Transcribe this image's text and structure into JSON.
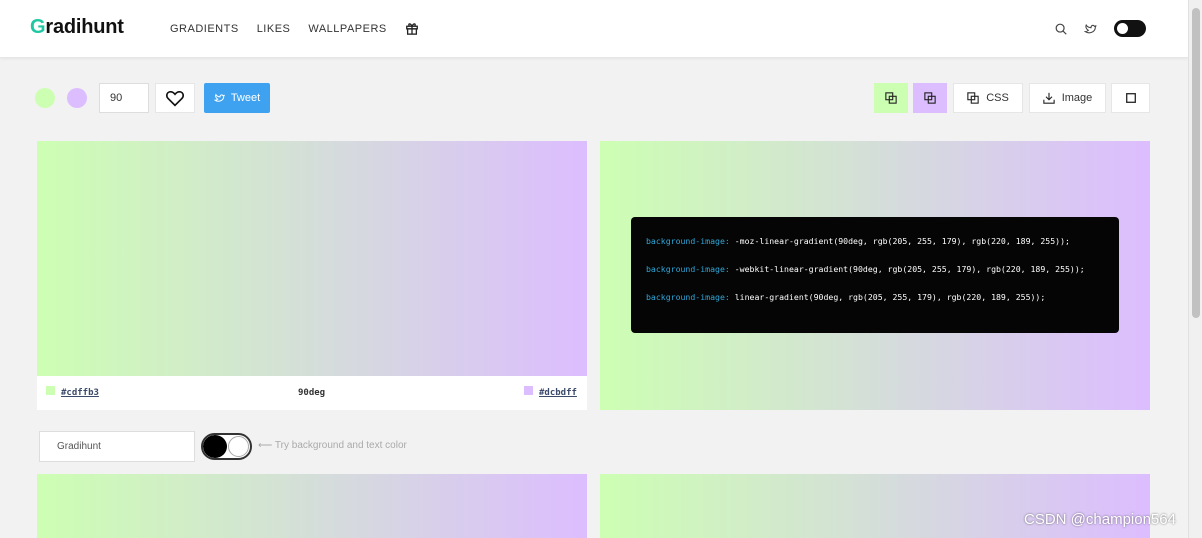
{
  "header": {
    "logo": "Gradihunt",
    "logo_first": "G",
    "logo_rest": "radihunt",
    "nav": [
      "GRADIENTS",
      "LIKES",
      "WALLPAPERS"
    ],
    "icons": [
      "gift-icon",
      "search-icon",
      "twitter-icon",
      "dark-mode-toggle"
    ]
  },
  "toolbar": {
    "color1": "#cdffb3",
    "color2": "#dcbdff",
    "degree_value": "90",
    "tweet_label": "Tweet",
    "css_label": "CSS",
    "image_label": "Image"
  },
  "gradient_card": {
    "color1_hex": "#cdffb3",
    "color2_hex": "#dcbdff",
    "degree_label": "90deg"
  },
  "code": {
    "lines": [
      {
        "prop": "background-image:",
        "value": " -moz-linear-gradient(90deg, rgb(205, 255, 179), rgb(220, 189, 255));"
      },
      {
        "prop": "background-image:",
        "value": " -webkit-linear-gradient(90deg, rgb(205, 255, 179), rgb(220, 189, 255));"
      },
      {
        "prop": "background-image:",
        "value": " linear-gradient(90deg, rgb(205, 255, 179), rgb(220, 189, 255));"
      }
    ]
  },
  "preview": {
    "text_value": "Gradihunt",
    "hint": "⟵ Try background and text color"
  },
  "watermark": "CSDN @champion564",
  "colors": {
    "accent_green": "#cdffb3",
    "accent_purple": "#dcbdff",
    "tweet_blue": "#3fa2f0"
  }
}
